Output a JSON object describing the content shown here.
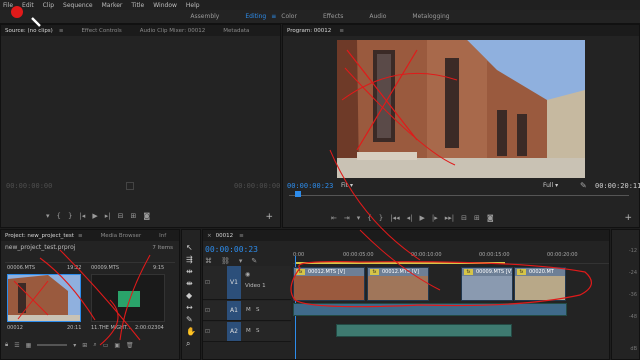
{
  "menu": [
    "File",
    "Edit",
    "Clip",
    "Sequence",
    "Marker",
    "Title",
    "Window",
    "Help"
  ],
  "workspaces": {
    "items": [
      "Assembly",
      "Editing",
      "Color",
      "Effects",
      "Audio",
      "Metalogging"
    ],
    "active": "Editing",
    "separator": "≡"
  },
  "source_panel": {
    "tabs": [
      "Source: (no clips)",
      "≡",
      "Effect Controls",
      "Audio Clip Mixer: 00012",
      "Metadata"
    ],
    "timecode_left": "00:00:00:00",
    "timecode_right": "00:00:00:00"
  },
  "program_panel": {
    "title": "Program: 00012",
    "menu_icon": "≡",
    "timecode_current": "00:00:00:23",
    "fit": "Fit",
    "quality": "Full",
    "timecode_duration": "00:00:20:11"
  },
  "project_panel": {
    "tabs": [
      "Project: new_project_test",
      "≡",
      "Media Browser",
      "Inf"
    ],
    "filename": "new_project_test.prproj",
    "item_count": "7 Items",
    "items": [
      {
        "name": "00006.MTS",
        "duration": "19:22"
      },
      {
        "name": "00009.MTS",
        "duration": "9:15"
      },
      {
        "name": "00012",
        "duration": "20:11"
      },
      {
        "name": "11.THE MIGHT…",
        "duration": "2:00:02304"
      }
    ]
  },
  "timeline": {
    "tab": "00012",
    "menu_icon": "≡",
    "timecode": "00:00:00:23",
    "ruler": [
      "0:00",
      "00:00:05:00",
      "00:00:10:00",
      "00:00:15:00",
      "00:00:20:00"
    ],
    "tracks": [
      {
        "id": "V1",
        "name": "Video 1"
      },
      {
        "id": "A1",
        "m": "M",
        "s": "S"
      },
      {
        "id": "A2",
        "m": "M",
        "s": "S"
      }
    ],
    "clips": [
      "00012.MTS [V]",
      "00012.MTS [V]",
      "00009.MTS [V]",
      "00020.MT"
    ],
    "fx": "fx"
  },
  "vu_meter": {
    "labels": [
      "-12",
      "-24",
      "-36",
      "-48",
      "dB"
    ]
  },
  "colors": {
    "accent": "#2d8ceb",
    "video_clip": "#4a6b8f",
    "audio_clip": "#3e7a70",
    "annotation": "#e01a1a"
  }
}
